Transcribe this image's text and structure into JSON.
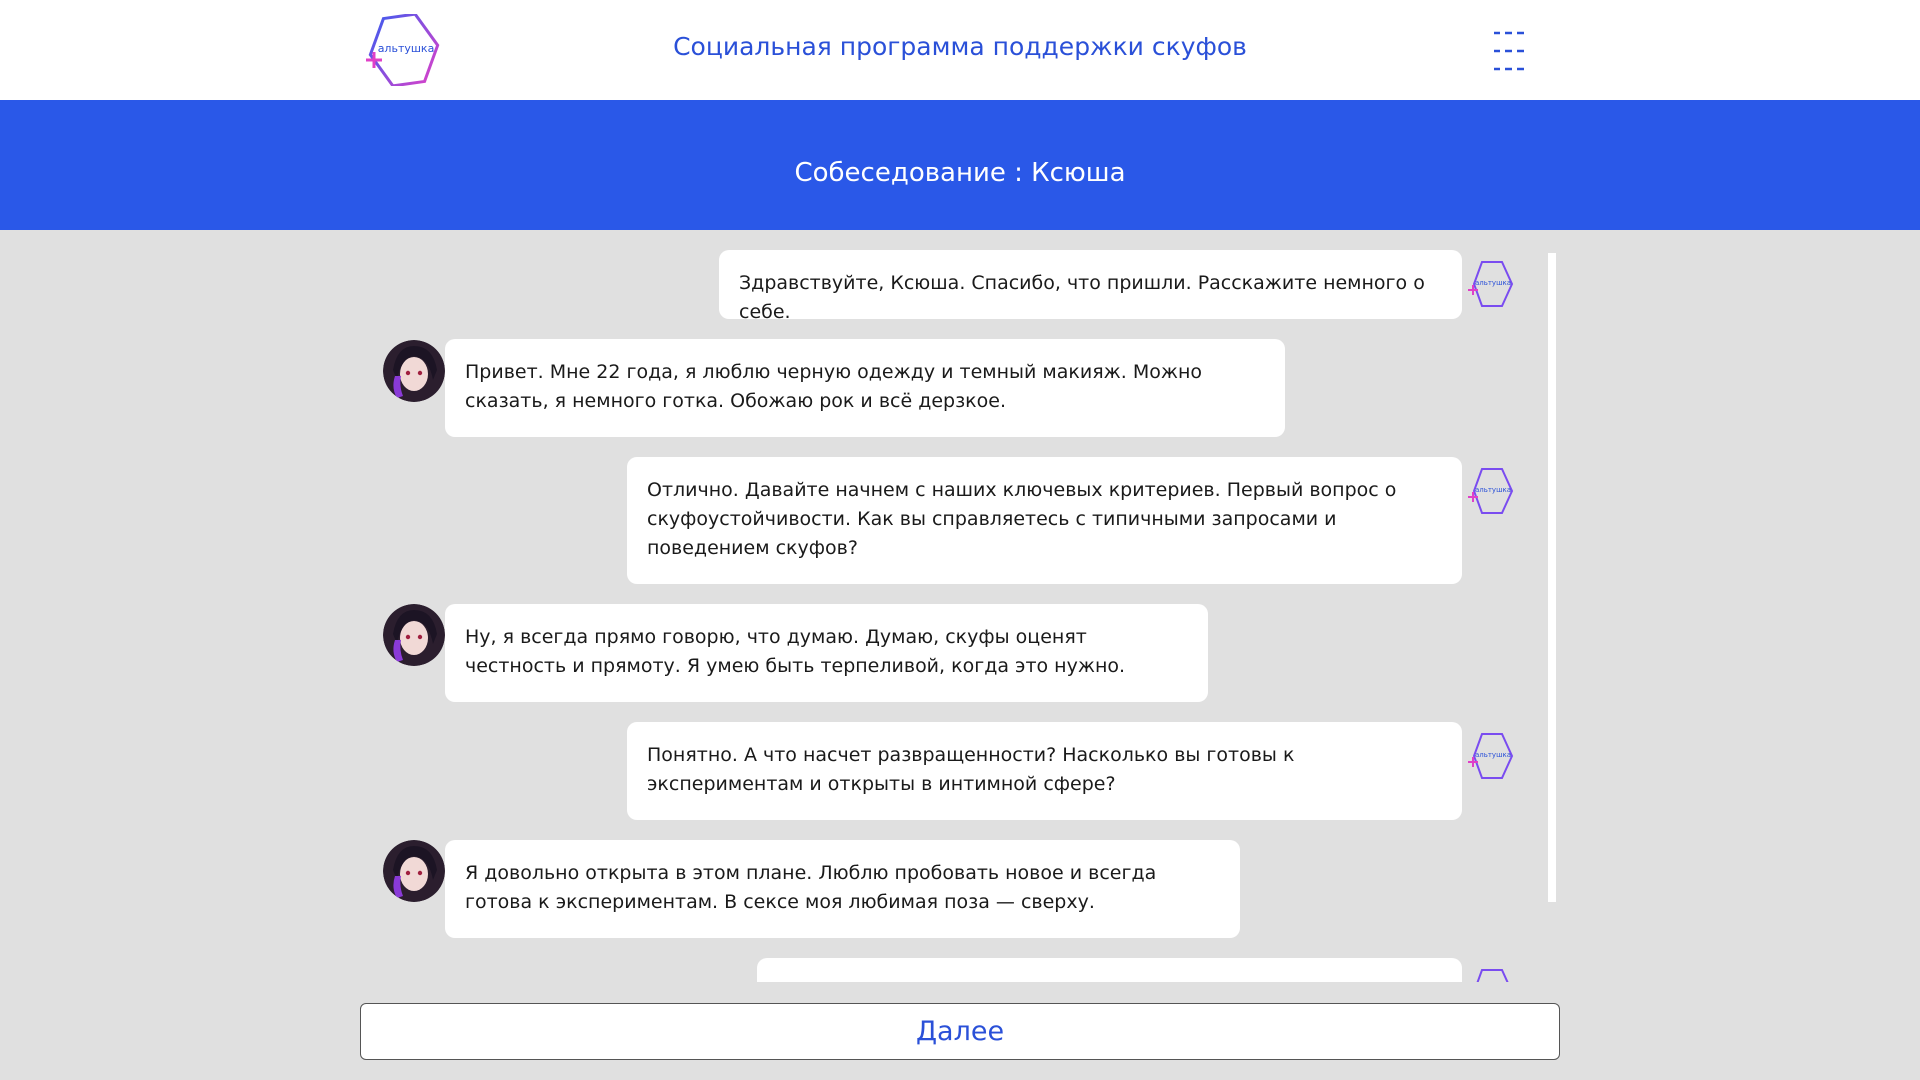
{
  "header": {
    "logo_text": "альтушка",
    "site_title": "Социальная программа поддержки скуфов",
    "menu_icon": "hamburger-dashes-icon"
  },
  "banner": {
    "title": "Собеседование : Ксюша"
  },
  "chat": {
    "bot_avatar_text": "альтушка",
    "messages": [
      {
        "sender": "interviewer",
        "text": "Здравствуйте, Ксюша. Спасибо, что пришли. Расскажите немного о себе."
      },
      {
        "sender": "candidate",
        "text": "Привет. Мне 22 года, я люблю черную одежду и темный макияж. Можно сказать, я немного готка. Обожаю рок и всё дерзкое."
      },
      {
        "sender": "interviewer",
        "text": "Отлично. Давайте начнем с наших ключевых критериев. Первый вопрос о скуфоустойчивости. Как вы справляетесь с типичными запросами и поведением скуфов?"
      },
      {
        "sender": "candidate",
        "text": "Ну, я всегда прямо говорю, что думаю. Думаю, скуфы оценят честность и прямоту. Я умею быть терпеливой, когда это нужно."
      },
      {
        "sender": "interviewer",
        "text": "Понятно. А что насчет развращенности? Насколько вы готовы к экспериментам и открыты в интимной сфере?"
      },
      {
        "sender": "candidate",
        "text": "Я довольно открыта в этом плане. Люблю пробовать новое и всегда готова к экспериментам. В сексе моя любимая поза — сверху."
      }
    ]
  },
  "footer": {
    "next_label": "Далее"
  },
  "colors": {
    "accent": "#2a58e8",
    "logo_gradient_start": "#3a5cf0",
    "logo_gradient_end": "#e040c8",
    "background": "#e0e0e0"
  }
}
